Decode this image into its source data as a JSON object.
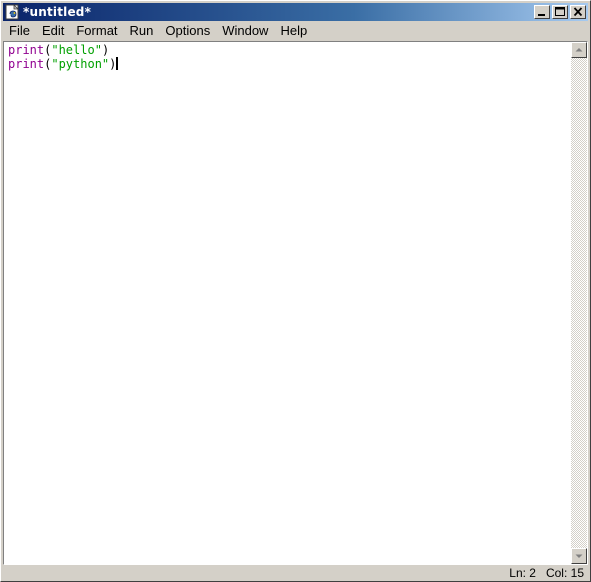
{
  "window": {
    "title": "*untitled*",
    "app_icon": "python-idle-icon",
    "buttons": [
      "minimize-icon",
      "maximize-icon",
      "close-icon"
    ]
  },
  "menubar": {
    "items": [
      {
        "label": "File"
      },
      {
        "label": "Edit"
      },
      {
        "label": "Format"
      },
      {
        "label": "Run"
      },
      {
        "label": "Options"
      },
      {
        "label": "Window"
      },
      {
        "label": "Help"
      }
    ]
  },
  "editor": {
    "lines": [
      {
        "kw": "print",
        "open": "(",
        "str": "\"hello\"",
        "close": ")"
      },
      {
        "kw": "print",
        "open": "(",
        "str": "\"python\"",
        "close": ")"
      }
    ],
    "colors": {
      "keyword": "#900090",
      "string": "#00a000"
    }
  },
  "status": {
    "line": "Ln: 2",
    "col": "Col: 15"
  },
  "colors": {
    "titlebar_start": "#0a246a",
    "titlebar_end": "#a6caf0",
    "chrome": "#d4d0c8"
  }
}
